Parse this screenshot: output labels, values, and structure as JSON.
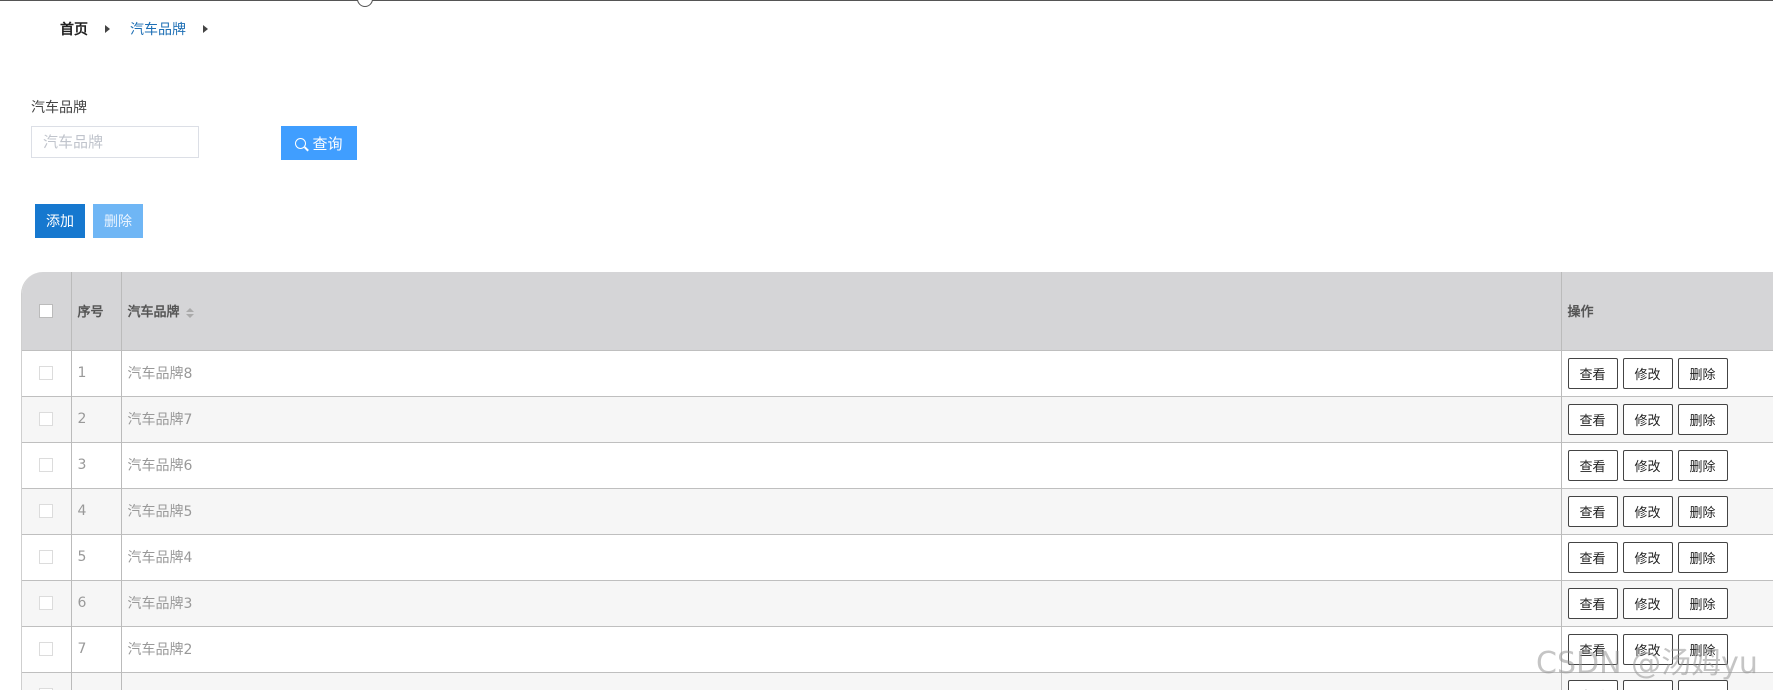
{
  "breadcrumb": {
    "home": "首页",
    "current": "汽车品牌"
  },
  "filter": {
    "label": "汽车品牌",
    "placeholder": "汽车品牌",
    "value": "",
    "query_button": "查询"
  },
  "toolbar": {
    "add_label": "添加",
    "delete_label": "删除"
  },
  "table": {
    "headers": {
      "index": "序号",
      "brand": "汽车品牌",
      "ops": "操作"
    },
    "rows": [
      {
        "index": "1",
        "brand": "汽车品牌8"
      },
      {
        "index": "2",
        "brand": "汽车品牌7"
      },
      {
        "index": "3",
        "brand": "汽车品牌6"
      },
      {
        "index": "4",
        "brand": "汽车品牌5"
      },
      {
        "index": "5",
        "brand": "汽车品牌4"
      },
      {
        "index": "6",
        "brand": "汽车品牌3"
      },
      {
        "index": "7",
        "brand": "汽车品牌2"
      },
      {
        "index": "",
        "brand": ""
      }
    ],
    "row_actions": {
      "view": "查看",
      "edit": "修改",
      "delete": "删除"
    }
  },
  "watermark": "CSDN @汤姆yu",
  "colors": {
    "primary": "#1678cf",
    "query": "#409eff",
    "disabled_delete": "#6fb6f5",
    "header_bg": "#d5d5d7"
  }
}
